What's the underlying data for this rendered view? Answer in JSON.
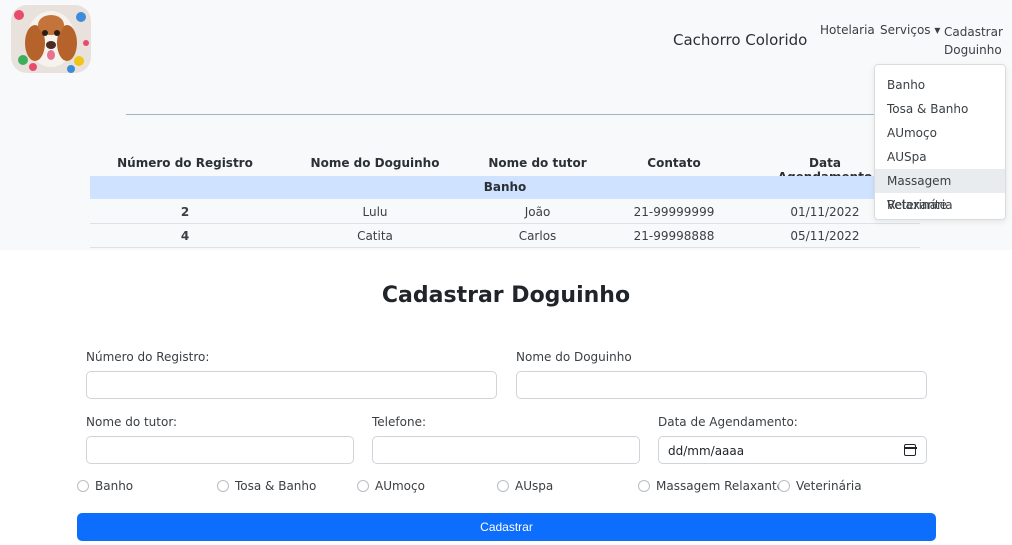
{
  "nav": {
    "brand": "Cachorro Colorido",
    "links": {
      "hotelaria": "Hotelaria",
      "servicos": "Serviços ▾",
      "cadastrar_line1": "Cadastrar",
      "cadastrar_line2": "Doguinho"
    },
    "dropdown": [
      "Banho",
      "Tosa & Banho",
      "AUmoço",
      "AUSpa",
      "Massagem Relaxante",
      "Veterinária"
    ]
  },
  "table": {
    "headers": [
      "Número do Registro",
      "Nome do Doguinho",
      "Nome do tutor",
      "Contato",
      "Data Agendamento"
    ],
    "group": "Banho",
    "rows": [
      [
        "2",
        "Lulu",
        "João",
        "21-99999999",
        "01/11/2022"
      ],
      [
        "4",
        "Catita",
        "Carlos",
        "21-99998888",
        "05/11/2022"
      ]
    ]
  },
  "form": {
    "title": "Cadastrar Doguinho",
    "labels": {
      "registro": "Número do Registro:",
      "doguinho": "Nome do Doguinho",
      "tutor": "Nome do tutor:",
      "telefone": "Telefone:",
      "data": "Data de Agendamento:"
    },
    "date_placeholder": "dd/mm/aaaa",
    "services": [
      "Banho",
      "Tosa & Banho",
      "AUmoço",
      "AUspa",
      "Massagem Relaxante",
      "Veterinária"
    ],
    "submit": "Cadastrar"
  },
  "colors": {
    "primary": "#0d6efd",
    "table_group_bg": "#cfe2ff",
    "dropdown_active_bg": "#e9ecef"
  }
}
